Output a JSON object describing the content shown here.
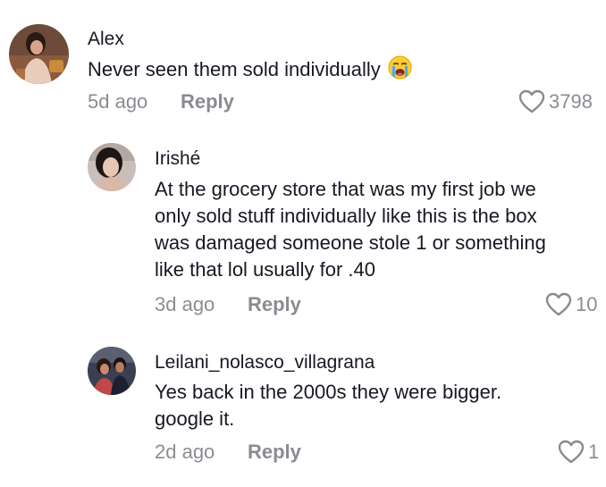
{
  "comments": [
    {
      "username": "Alex",
      "text_lines": [
        "Never seen them sold individually"
      ],
      "emoji": "loudly-crying-face",
      "time": "5d ago",
      "reply_label": "Reply",
      "likes": "3798"
    },
    {
      "username": "Irishé",
      "text_lines": [
        "At the grocery store that was my first job we",
        "only sold stuff individually like this is the box",
        "was damaged someone stole 1 or something",
        "like that lol usually for .40"
      ],
      "time": "3d ago",
      "reply_label": "Reply",
      "likes": "10"
    },
    {
      "username": "Leilani_nolasco_villagrana",
      "text_lines": [
        "Yes back in the 2000s they were bigger.",
        "google it."
      ],
      "time": "2d ago",
      "reply_label": "Reply",
      "likes": "1"
    }
  ],
  "icons": {
    "like": "heart-outline-icon"
  },
  "colors": {
    "primary_text": "#161823",
    "secondary_text": "#8a8b91"
  }
}
